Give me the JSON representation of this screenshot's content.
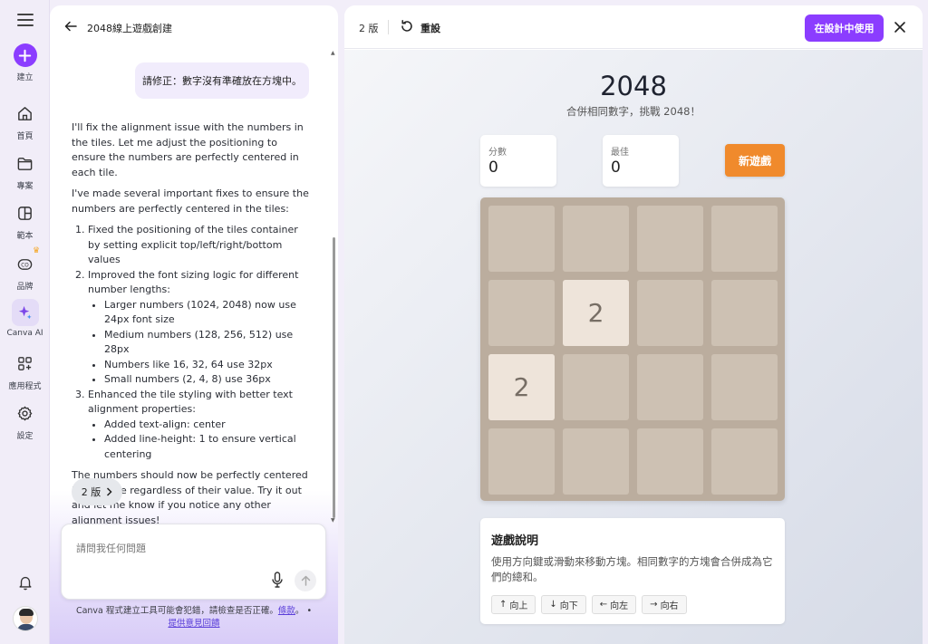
{
  "rail": {
    "items": [
      {
        "label": "建立",
        "icon": "plus-icon"
      },
      {
        "label": "首頁",
        "icon": "home-icon"
      },
      {
        "label": "專案",
        "icon": "folder-icon"
      },
      {
        "label": "範本",
        "icon": "template-icon"
      },
      {
        "label": "品牌",
        "icon": "brand-icon"
      },
      {
        "label": "Canva AI",
        "icon": "sparkle-icon"
      },
      {
        "label": "應用程式",
        "icon": "apps-icon"
      },
      {
        "label": "設定",
        "icon": "gear-icon"
      }
    ]
  },
  "chat": {
    "title": "2048線上遊戲創建",
    "user_message": "請修正：數字沒有準確放在方塊中。",
    "reply": {
      "p1": "I'll fix the alignment issue with the numbers in the tiles. Let me adjust the positioning to ensure the numbers are perfectly centered in each tile.",
      "p2": "I've made several important fixes to ensure the numbers are perfectly centered in the tiles:",
      "item1": "Fixed the positioning of the tiles container by setting explicit top/left/right/bottom values",
      "item2": "Improved the font sizing logic for different number lengths:",
      "item2_sub": [
        "Larger numbers (1024, 2048) now use 24px font size",
        "Medium numbers (128, 256, 512) use 28px",
        "Numbers like 16, 32, 64 use 32px",
        "Small numbers (2, 4, 8) use 36px"
      ],
      "item3": "Enhanced the tile styling with better text alignment properties:",
      "item3_sub": [
        "Added text-align: center",
        "Added line-height: 1 to ensure vertical centering"
      ],
      "p3": "The numbers should now be perfectly centered in each tile regardless of their value. Try it out and let me know if you notice any other alignment issues!"
    },
    "version_pill": "2 版",
    "input_placeholder": "請問我任何問題",
    "disclaimer_text": "Canva 程式建立工具可能會犯錯，請檢查是否正確。",
    "terms_link": "條款",
    "feedback_link": "提供意見回饋"
  },
  "preview": {
    "version": "2 版",
    "reload_label": "重設",
    "use_button": "在設計中使用",
    "accent_color": "#8b3dff"
  },
  "game": {
    "title": "2048",
    "subtitle": "合併相同數字，挑戰 2048！",
    "score_label": "分數",
    "score_value": "0",
    "best_label": "最佳",
    "best_value": "0",
    "new_game": "新遊戲",
    "tiles": [
      {
        "row": 1,
        "col": 1,
        "value": "2"
      },
      {
        "row": 2,
        "col": 0,
        "value": "2"
      }
    ],
    "instructions_title": "遊戲說明",
    "instructions_text": "使用方向鍵或滑動來移動方塊。相同數字的方塊會合併成為它們的總和。",
    "keys": [
      {
        "arrow": "↑",
        "label": "向上"
      },
      {
        "arrow": "↓",
        "label": "向下"
      },
      {
        "arrow": "←",
        "label": "向左"
      },
      {
        "arrow": "→",
        "label": "向右"
      }
    ]
  }
}
